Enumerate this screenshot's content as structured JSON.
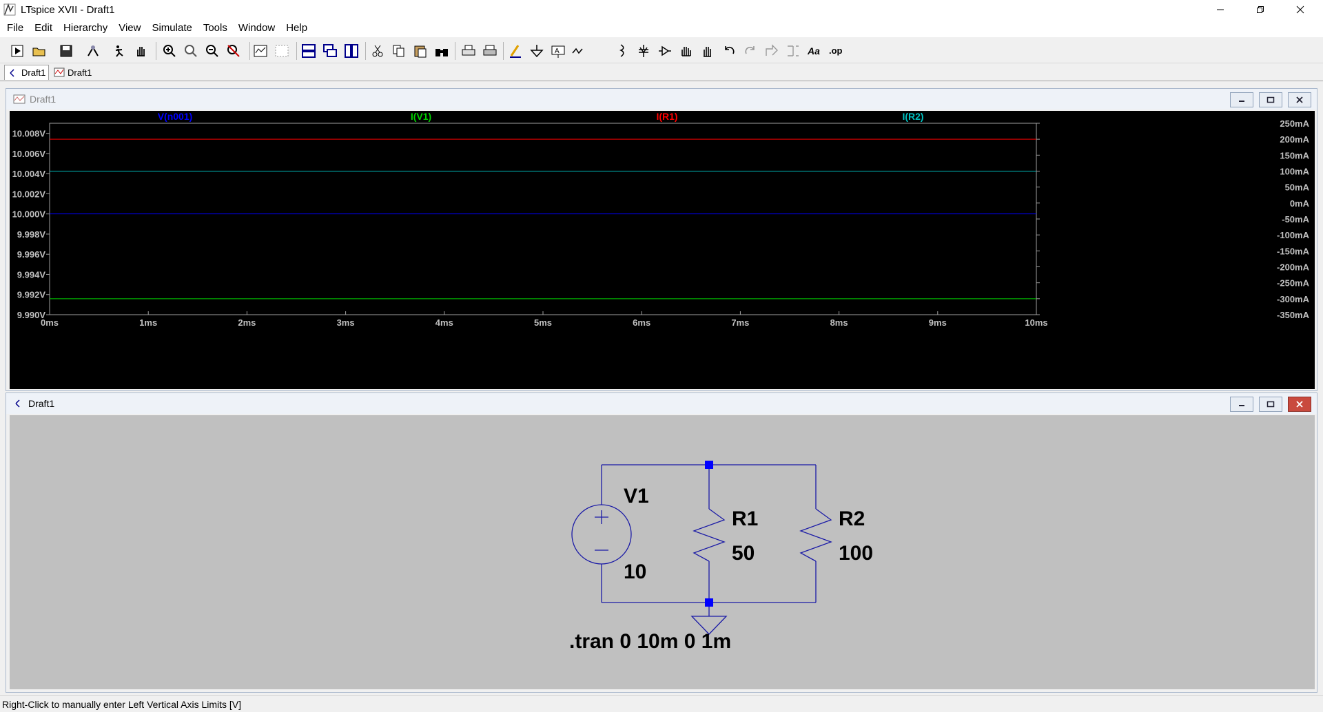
{
  "app": {
    "title": "LTspice XVII - Draft1"
  },
  "menu": [
    {
      "key": "F",
      "rest": "ile"
    },
    {
      "key": "E",
      "rest": "dit"
    },
    {
      "key": "",
      "rest": "Hierarchy",
      "u": "a"
    },
    {
      "key": "V",
      "rest": "iew"
    },
    {
      "key": "S",
      "rest": "imulate"
    },
    {
      "key": "T",
      "rest": "ools"
    },
    {
      "key": "W",
      "rest": "indow"
    },
    {
      "key": "H",
      "rest": "elp"
    }
  ],
  "menu_labels": [
    "File",
    "Edit",
    "Hierarchy",
    "View",
    "Simulate",
    "Tools",
    "Window",
    "Help"
  ],
  "toolbar_icons": [
    "run-icon",
    "open-icon",
    "save-icon",
    "control-panel-icon",
    "halt-icon",
    "pan-icon",
    "zoom-in-icon",
    "zoom-rect-icon",
    "zoom-out-icon",
    "zoom-fit-icon",
    "autorange-icon",
    "delete-trace-icon",
    "tile-horizontal-icon",
    "cascade-icon",
    "tile-vertical-icon",
    "cut-icon",
    "copy-icon",
    "paste-icon",
    "find-icon",
    "print-icon",
    "print-setup-icon",
    "draw-wire-icon",
    "ground-icon",
    "label-net-icon",
    "component-icon",
    "resistor-icon",
    "capacitor-icon",
    "inductor-icon",
    "diode-icon",
    "move-icon",
    "drag-icon",
    "undo-icon",
    "redo-icon",
    "rotate-icon",
    "mirror-icon",
    "text-icon",
    "spice-directive-icon"
  ],
  "tabs": [
    {
      "label": "Draft1",
      "icon": "schematic-icon"
    },
    {
      "label": "Draft1",
      "icon": "waveform-icon"
    }
  ],
  "wave_window": {
    "title": "Draft1"
  },
  "schematic_window": {
    "title": "Draft1"
  },
  "chart_data": {
    "type": "line",
    "title": "",
    "xlabel": "",
    "x_ticks": [
      "0ms",
      "1ms",
      "2ms",
      "3ms",
      "4ms",
      "5ms",
      "6ms",
      "7ms",
      "8ms",
      "9ms",
      "10ms"
    ],
    "xlim": [
      0,
      10
    ],
    "left_axis": {
      "unit": "V",
      "ylim": [
        9.99,
        10.009
      ],
      "ticks": [
        "10.008V",
        "10.006V",
        "10.004V",
        "10.002V",
        "10.000V",
        "9.998V",
        "9.996V",
        "9.994V",
        "9.992V",
        "9.990V"
      ],
      "tick_values": [
        10.008,
        10.006,
        10.004,
        10.002,
        10.0,
        9.998,
        9.996,
        9.994,
        9.992,
        9.99
      ]
    },
    "right_axis": {
      "unit": "mA",
      "ylim": [
        -350,
        250
      ],
      "ticks": [
        "250mA",
        "200mA",
        "150mA",
        "100mA",
        "50mA",
        "0mA",
        "-50mA",
        "-100mA",
        "-150mA",
        "-200mA",
        "-250mA",
        "-300mA",
        "-350mA"
      ],
      "tick_values": [
        250,
        200,
        150,
        100,
        50,
        0,
        -50,
        -100,
        -150,
        -200,
        -250,
        -300,
        -350
      ]
    },
    "grid": false,
    "series": [
      {
        "name": "V(n001)",
        "color": "#0000ff",
        "axis": "left",
        "x": [
          0,
          10
        ],
        "values": [
          10.0,
          10.0
        ]
      },
      {
        "name": "I(V1)",
        "color": "#00d000",
        "axis": "right",
        "x": [
          0,
          10
        ],
        "values": [
          -300,
          -300
        ]
      },
      {
        "name": "I(R1)",
        "color": "#ff0000",
        "axis": "right",
        "x": [
          0,
          10
        ],
        "values": [
          200,
          200
        ]
      },
      {
        "name": "I(R2)",
        "color": "#00c0c0",
        "axis": "right",
        "x": [
          0,
          10
        ],
        "values": [
          100,
          100
        ]
      }
    ]
  },
  "schematic": {
    "v1_name": "V1",
    "v1_value": "10",
    "r1_name": "R1",
    "r1_value": "50",
    "r2_name": "R2",
    "r2_value": "100",
    "directive": ".tran 0 10m 0 1m",
    "wire_color": "#0000c8"
  },
  "status": {
    "text": "Right-Click to manually enter Left Vertical Axis Limits [V]"
  }
}
